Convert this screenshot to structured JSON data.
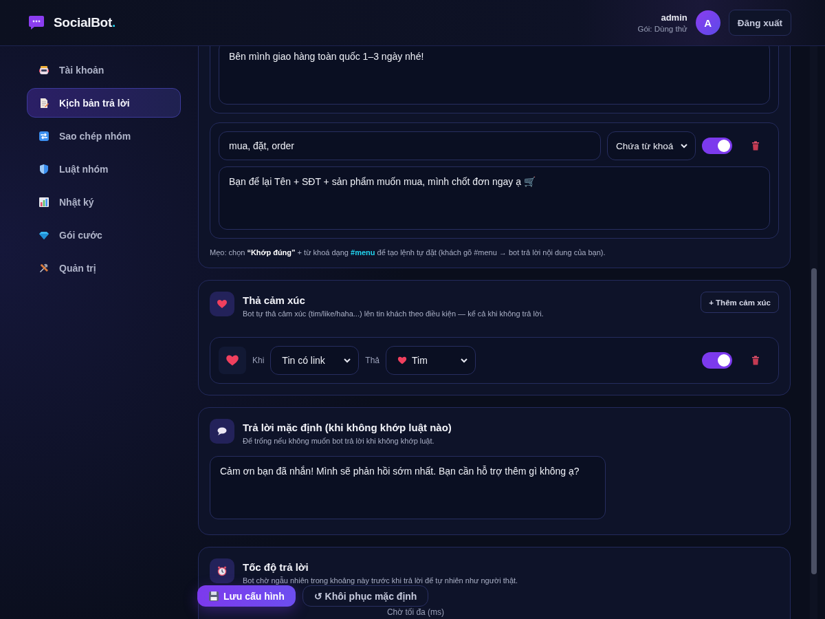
{
  "brand": {
    "name": "SocialBot",
    "mark": "."
  },
  "account": {
    "name": "admin",
    "plan": "Gói: Dùng thử",
    "avatar": "A",
    "logout": "Đăng xuất"
  },
  "sidebar": {
    "items": [
      {
        "label": "Tài khoản",
        "selected": false
      },
      {
        "label": "Kịch bản trả lời",
        "selected": true
      },
      {
        "label": "Sao chép nhóm",
        "selected": false
      },
      {
        "label": "Luật nhóm",
        "selected": false
      },
      {
        "label": "Nhật ký",
        "selected": false
      },
      {
        "label": "Gói cước",
        "selected": false
      },
      {
        "label": "Quản trị",
        "selected": false
      }
    ]
  },
  "keyword_rules": {
    "rules": [
      {
        "reply": "Bên mình giao hàng toàn quốc 1–3 ngày nhé!"
      },
      {
        "keywords": "mua, đặt, order",
        "match": "Chứa từ khoá",
        "on": true,
        "reply": "Bạn để lại Tên + SĐT + sản phẩm muốn mua, mình chốt đơn ngay ạ 🛒"
      }
    ],
    "tip": [
      {
        "kind": "plain",
        "text": "Mẹo: chọn "
      },
      {
        "kind": "strong",
        "text": "“Khớp đúng”"
      },
      {
        "kind": "plain",
        "text": " + từ khoá dạng "
      },
      {
        "kind": "code",
        "text": "#menu"
      },
      {
        "kind": "plain",
        "text": " để tạo lệnh tự đặt (khách gõ #menu → bot trả lời nội dung của bạn)."
      }
    ]
  },
  "reactions": {
    "title": "Thả cảm xúc",
    "description": "Bot tự thả cảm xúc (tim/like/haha...) lên tin khách theo điều kiện — kể cả khi không trả lời.",
    "add_button": "+ Thêm cảm xúc",
    "rules": [
      {
        "when_label": "Khi",
        "when": "Tin có link",
        "react_label": "Thả",
        "reaction": "Tim",
        "on": true
      }
    ]
  },
  "default_reply": {
    "title": "Trả lời mặc định (khi không khớp luật nào)",
    "description": "Để trống nếu không muốn bot trả lời khi không khớp luật.",
    "value": "Cảm ơn bạn đã nhắn! Mình sẽ phản hồi sớm nhất. Bạn cần hỗ trợ thêm gì không ạ?"
  },
  "reply_speed": {
    "title": "Tốc độ trả lời",
    "description": "Bot chờ ngẫu nhiên trong khoảng này trước khi trả lời để tự nhiên như người thật.",
    "fields": [
      {
        "label": "Chờ tối đa (ms)"
      }
    ]
  },
  "actions": [
    {
      "kind": "primary",
      "label": "Lưu cấu hình"
    },
    {
      "kind": "secondary",
      "label": "↺ Khôi phục mặc định"
    }
  ]
}
